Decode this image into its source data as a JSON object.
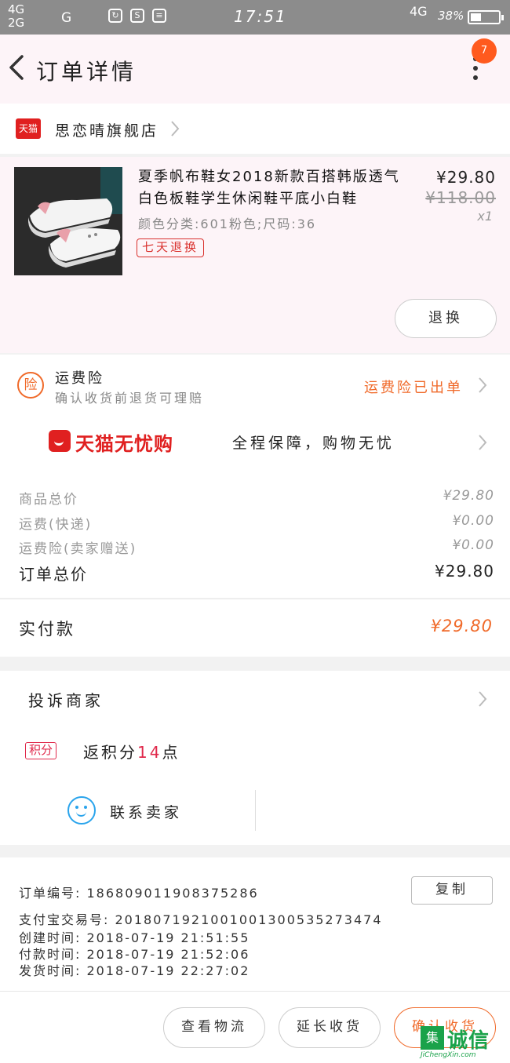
{
  "status_bar": {
    "signal_1": "4G",
    "signal_2": "2G",
    "signal_3": "G",
    "time": "17:51",
    "network": "4G",
    "battery": "38%",
    "battery_level": 0.38
  },
  "nav": {
    "title": "订单详情",
    "badge_count": "7"
  },
  "store": {
    "logo_text": "天猫",
    "name": "思恋晴旗舰店"
  },
  "product": {
    "title": "夏季帆布鞋女2018新款百搭韩版透气白色板鞋学生休闲鞋平底小白鞋",
    "sku": "颜色分类:601粉色;尺码:36",
    "tag": "七天退换",
    "price": "¥29.80",
    "original_price": "¥118.00",
    "quantity": "x1",
    "exchange_button": "退换"
  },
  "insurance": {
    "icon_text": "险",
    "title": "运费险",
    "subtitle": "确认收货前退货可理赔",
    "status": "运费险已出单"
  },
  "wuyou": {
    "brand": "天猫无忧购",
    "slogan": "全程保障，购物无忧"
  },
  "summary": {
    "rows": [
      {
        "label": "商品总价",
        "value": "¥29.80"
      },
      {
        "label": "运费(快递)",
        "value": "¥0.00"
      },
      {
        "label": "运费险(卖家赠送)",
        "value": "¥0.00"
      },
      {
        "label": "订单总价",
        "value": "¥29.80"
      }
    ]
  },
  "paid": {
    "label": "实付款",
    "value": "¥29.80"
  },
  "actions": {
    "complain": "投诉商家",
    "points_tag": "积分",
    "points_prefix": "返积分",
    "points_num": "14",
    "points_suffix": "点",
    "contact": "联系卖家"
  },
  "order_info": {
    "order_no": "订单编号:  1868090119083752​86",
    "alipay_no": "支付宝交易号:  2018071921001001300535273474",
    "created": "创建时间:  2018-07-19  21:51:55",
    "paid": "付款时间:  2018-07-19  21:52:06",
    "shipped": "发货时间:  2018-07-19  22:27:02",
    "copy_button": "复制"
  },
  "bottom": {
    "logistics": "查看物流",
    "extend": "延长收货",
    "confirm": "确认收货"
  },
  "watermark": {
    "box": "集",
    "cn": "诚信",
    "url": "JiChengXin.com"
  },
  "colors": {
    "accent": "#f06a2a",
    "tmall_red": "#e02020",
    "nav_bg": "#fdf4f8"
  }
}
